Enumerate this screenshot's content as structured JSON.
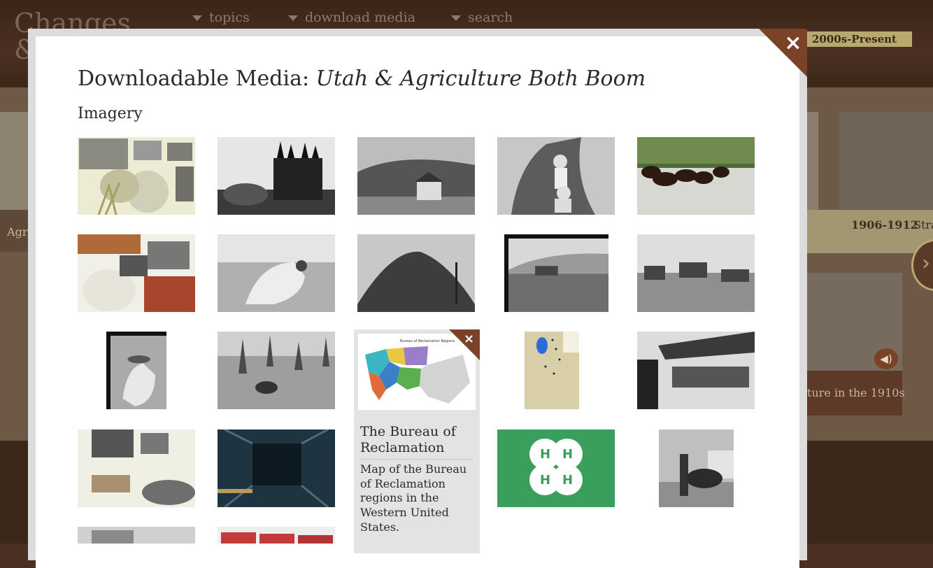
{
  "background": {
    "logo": "Changes\n& ",
    "nav": [
      {
        "label": "topics"
      },
      {
        "label": "download media"
      },
      {
        "label": "search"
      }
    ],
    "era_label": "2000s-Present",
    "left_caption": "Agr",
    "right_caption_1_year": "1906-1912",
    "right_caption_1_text": "Stra Valley Pro",
    "right_caption_2": "ture in the 1910s",
    "next_arrow": "›",
    "sound_icon": "speaker-icon"
  },
  "modal": {
    "title_prefix": "Downloadable Media: ",
    "title_topic": "Utah & Agriculture Both Boom",
    "section_title": "Imagery",
    "close_label": "×",
    "images": [
      {
        "name": "image-farm-collage",
        "tone": "collage-light"
      },
      {
        "name": "image-salt-lake-temple",
        "tone": "bw"
      },
      {
        "name": "image-farmhouse-hills",
        "tone": "bw"
      },
      {
        "name": "image-men-in-tree",
        "tone": "bw"
      },
      {
        "name": "image-cattle-drive",
        "tone": "color"
      },
      {
        "name": "image-cows-collage",
        "tone": "collage-color"
      },
      {
        "name": "image-worker-in-field",
        "tone": "bw"
      },
      {
        "name": "image-sugar-beet-pile",
        "tone": "bw"
      },
      {
        "name": "image-sugar-factory",
        "tone": "bw"
      },
      {
        "name": "image-wagons-harvest",
        "tone": "bw"
      },
      {
        "name": "image-worker-crouching",
        "tone": "bw"
      },
      {
        "name": "image-cattle-forest",
        "tone": "bw"
      },
      {
        "name": "image-bureau-map",
        "tone": "map"
      },
      {
        "name": "image-utah-map",
        "tone": "map"
      },
      {
        "name": "image-produce-market",
        "tone": "bw"
      },
      {
        "name": "image-barn-sheep-collage",
        "tone": "collage-light"
      },
      {
        "name": "image-tunnel-flume",
        "tone": "color-dark"
      },
      {
        "name": "image-4h-clover",
        "tone": "4h"
      },
      {
        "name": "image-boy-with-calf",
        "tone": "bw"
      },
      {
        "name": "image-building",
        "tone": "bw"
      },
      {
        "name": "image-canned-goods",
        "tone": "color"
      }
    ],
    "detail": {
      "title": "The Bureau of Reclamation",
      "description": "Map of the Bureau of Reclamation regions in the Western United States.",
      "close_label": "×",
      "map_title": "Bureau of Reclamation Regions"
    }
  },
  "colors": {
    "accent": "#7a4227",
    "era_badge": "#b8a970",
    "four_h_green": "#3a9e5c"
  }
}
